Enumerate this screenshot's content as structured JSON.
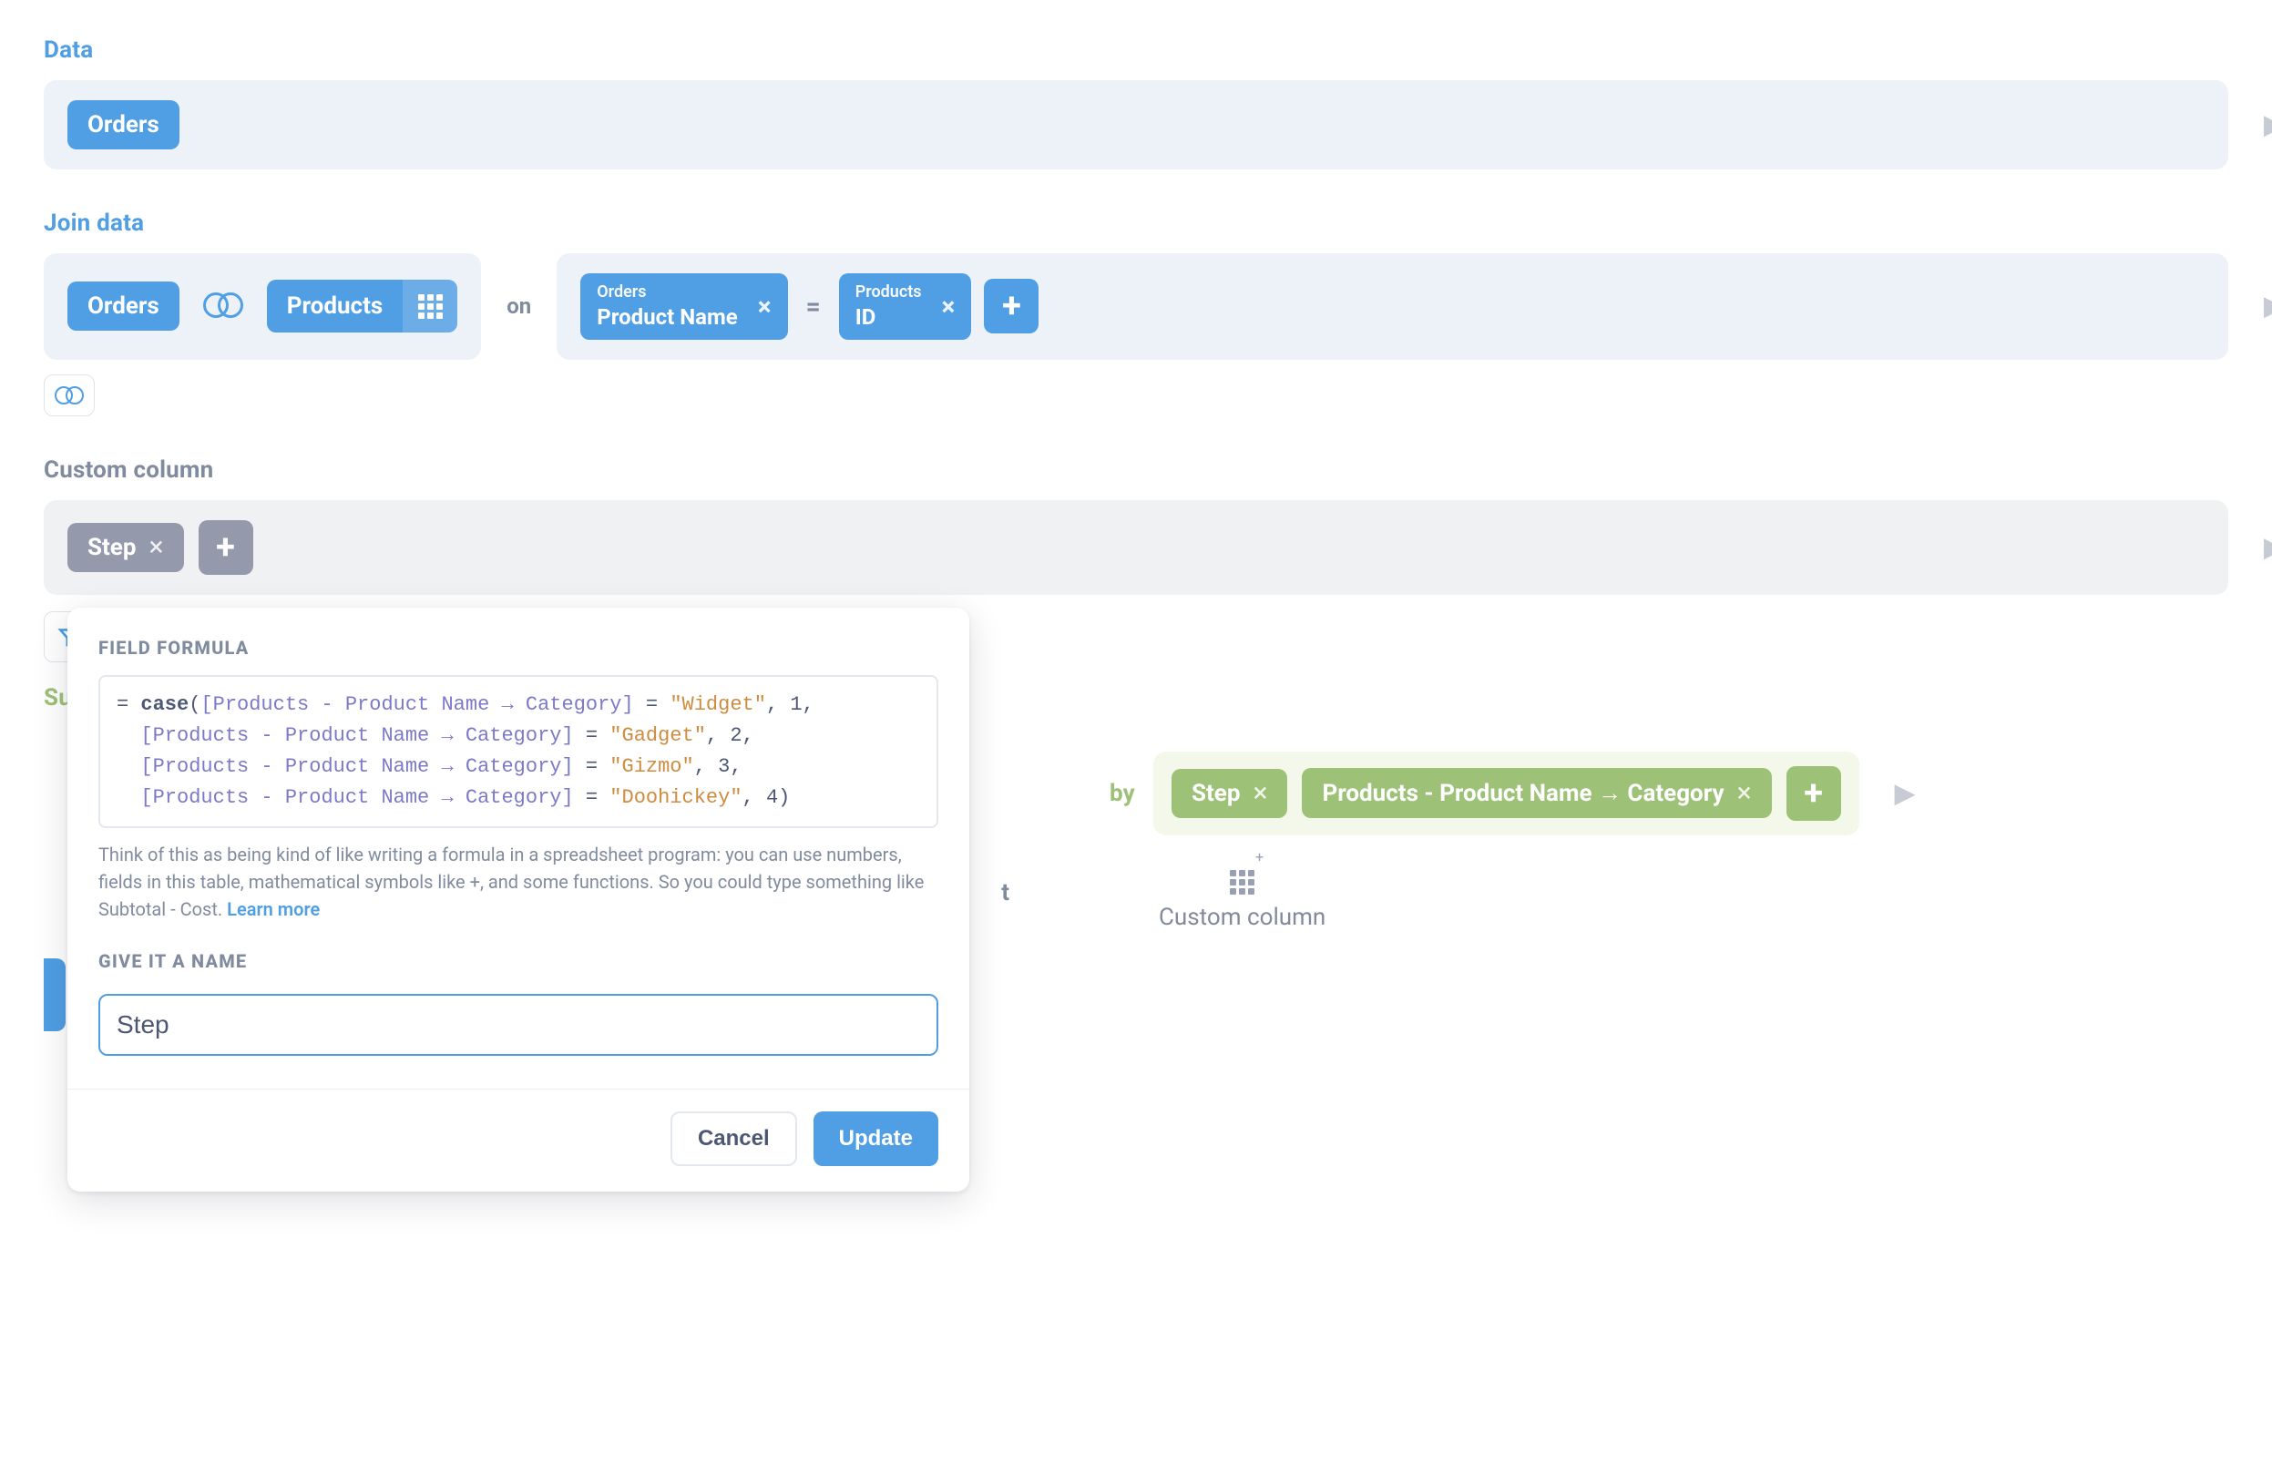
{
  "sections": {
    "data": {
      "label": "Data",
      "chip": "Orders"
    },
    "join": {
      "label": "Join data",
      "left_table": "Orders",
      "right_table": "Products",
      "on_text": "on",
      "eq_text": "=",
      "left_cond": {
        "table": "Orders",
        "field": "Product Name"
      },
      "right_cond": {
        "table": "Products",
        "field": "ID"
      }
    },
    "custom_column": {
      "label": "Custom column",
      "chip": "Step"
    },
    "summarize_hint": "Su",
    "sort": {
      "by_text": "by",
      "chip1": "Step",
      "chip2": "Products - Product Name → Category",
      "under_label": "Custom column",
      "row_limit_tail": "t"
    }
  },
  "popover": {
    "formula_label": "FIELD FORMULA",
    "code": {
      "eq": "= ",
      "kw": "case",
      "open": "(",
      "field1": "[Products - Product Name → Category]",
      "op": " = ",
      "s1": "\"Widget\"",
      "n1": "1",
      "s2": "\"Gadget\"",
      "n2": "2",
      "s3": "\"Gizmo\"",
      "n3": "3",
      "s4": "\"Doohickey\"",
      "n4": "4",
      "close": ")"
    },
    "help_text": "Think of this as being kind of like writing a formula in a spreadsheet program: you can use numbers, fields in this table, mathematical symbols like +, and some functions. So you could type something like Subtotal - Cost. ",
    "learn_more": "Learn more",
    "name_label": "GIVE IT A NAME",
    "name_value": "Step",
    "cancel": "Cancel",
    "update": "Update"
  }
}
